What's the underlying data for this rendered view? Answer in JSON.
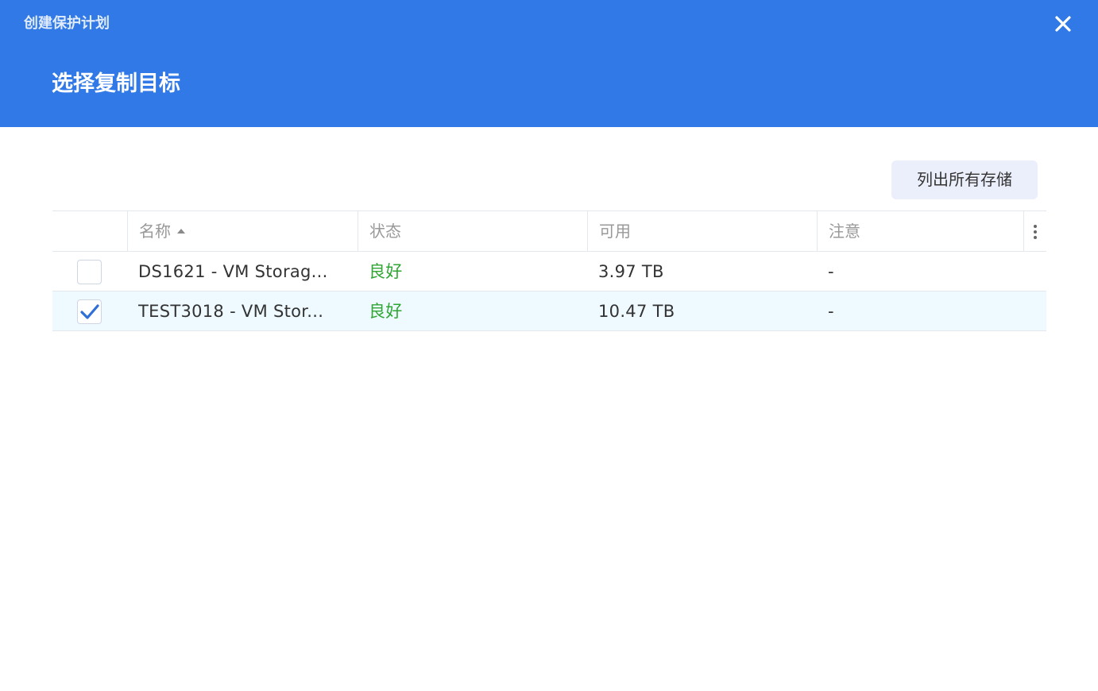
{
  "window": {
    "title": "创建保护计划",
    "close_icon": "close-icon"
  },
  "wizard": {
    "step_title": "选择复制目标"
  },
  "toolbar": {
    "list_all_label": "列出所有存储"
  },
  "table": {
    "columns": [
      {
        "label": "名称",
        "sorted": "asc"
      },
      {
        "label": "状态"
      },
      {
        "label": "可用"
      },
      {
        "label": "注意"
      }
    ],
    "rows": [
      {
        "checked": false,
        "name": "DS1621 - VM Storag...",
        "status": "良好",
        "available": "3.97 TB",
        "note": "-"
      },
      {
        "checked": true,
        "name": "TEST3018 - VM Stor...",
        "status": "良好",
        "available": "10.47 TB",
        "note": "-"
      }
    ]
  },
  "colors": {
    "header_bg": "#3079e6",
    "status_good": "#2fa533",
    "checkbox_check": "#2f6fd6",
    "selected_row_bg": "#eefaff"
  }
}
